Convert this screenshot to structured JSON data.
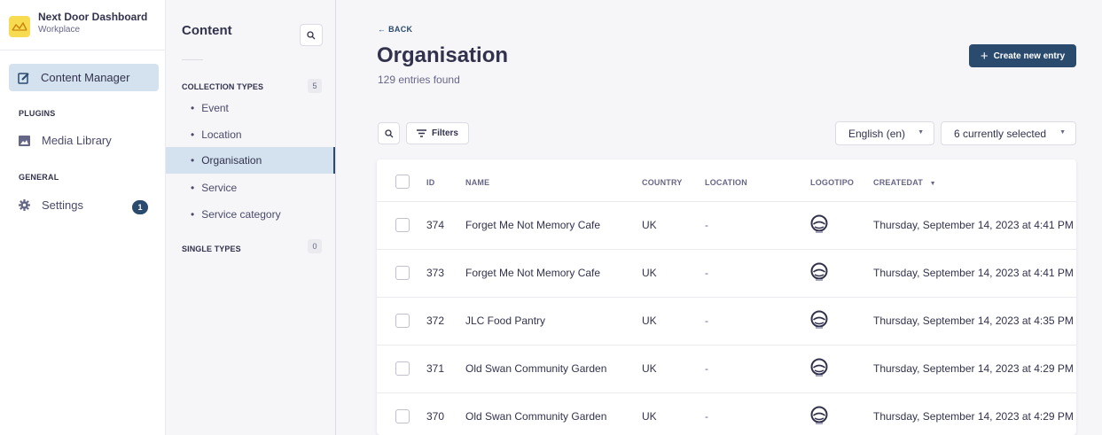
{
  "app": {
    "title": "Next Door Dashboard",
    "workspace": "Workplace",
    "brand_color": "#f7dc52",
    "accent": "#2a4a6e"
  },
  "nav": {
    "content_manager": "Content Manager",
    "plugins_label": "PLUGINS",
    "media_library": "Media Library",
    "general_label": "GENERAL",
    "settings": "Settings",
    "settings_badge": "1"
  },
  "content_nav": {
    "title": "Content",
    "collection_types_label": "COLLECTION TYPES",
    "collection_types_count": "5",
    "collection_types": [
      "Event",
      "Location",
      "Organisation",
      "Service",
      "Service category"
    ],
    "active_type": "Organisation",
    "single_types_label": "SINGLE TYPES",
    "single_types_count": "0"
  },
  "main": {
    "back_label": "BACK",
    "title": "Organisation",
    "entries_found": "129 entries found",
    "create_button": "Create new entry",
    "filters_button": "Filters",
    "locale_select": "English (en)",
    "columns_select": "6 currently selected"
  },
  "table": {
    "headers": [
      "ID",
      "NAME",
      "COUNTRY",
      "LOCATION",
      "LOGOTIPO",
      "CREATEDAT"
    ],
    "sorted_column": "CREATEDAT",
    "rows": [
      {
        "id": "374",
        "name": "Forget Me Not Memory Cafe",
        "country": "UK",
        "location": "-",
        "created": "Thursday, September 14, 2023 at 4:41 PM"
      },
      {
        "id": "373",
        "name": "Forget Me Not Memory Cafe",
        "country": "UK",
        "location": "-",
        "created": "Thursday, September 14, 2023 at 4:41 PM"
      },
      {
        "id": "372",
        "name": "JLC Food Pantry",
        "country": "UK",
        "location": "-",
        "created": "Thursday, September 14, 2023 at 4:35 PM"
      },
      {
        "id": "371",
        "name": "Old Swan Community Garden",
        "country": "UK",
        "location": "-",
        "created": "Thursday, September 14, 2023 at 4:29 PM"
      },
      {
        "id": "370",
        "name": "Old Swan Community Garden",
        "country": "UK",
        "location": "-",
        "created": "Thursday, September 14, 2023 at 4:29 PM"
      }
    ]
  }
}
